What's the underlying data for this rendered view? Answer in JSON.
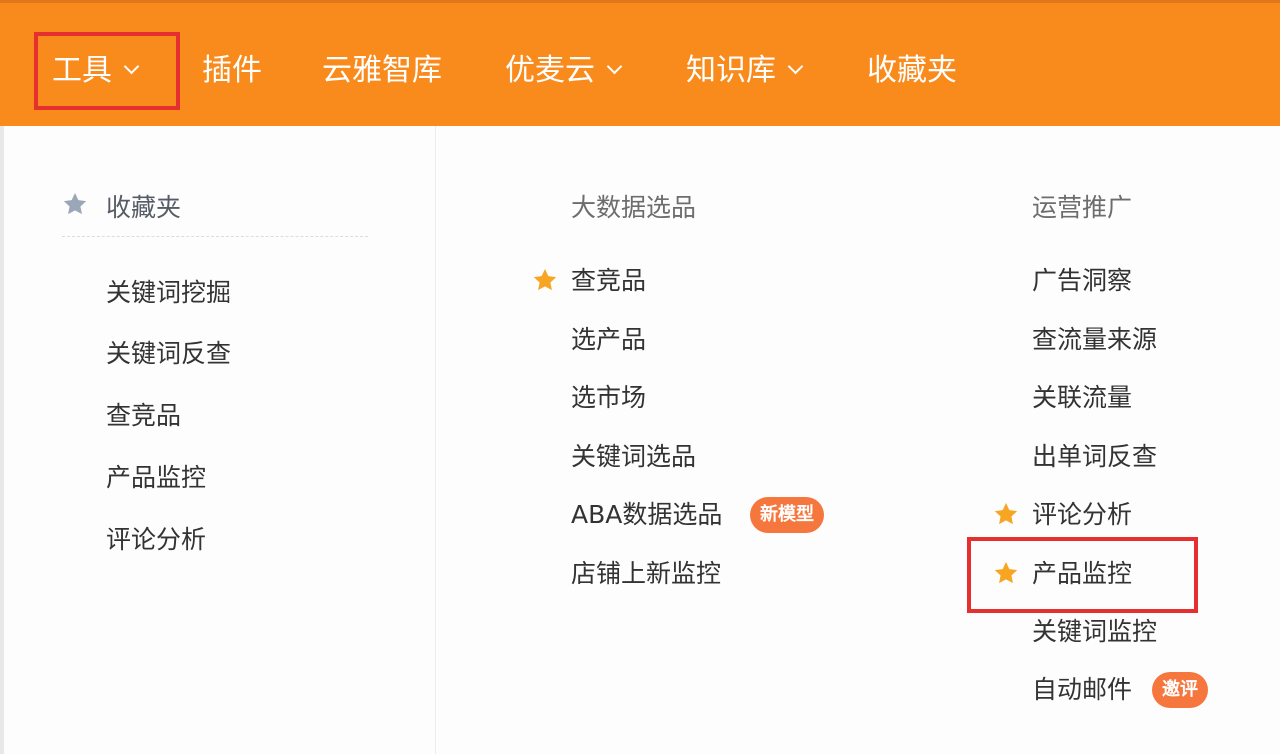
{
  "nav": {
    "tools": "工具",
    "plugins": "插件",
    "yunya": "云雅智库",
    "youmaiyun": "优麦云",
    "knowledge": "知识库",
    "favorites": "收藏夹"
  },
  "favorites_col": {
    "title": "收藏夹",
    "items": [
      "关键词挖掘",
      "关键词反查",
      "查竞品",
      "产品监控",
      "评论分析"
    ]
  },
  "bigdata_col": {
    "title": "大数据选品",
    "items": [
      "查竞品",
      "选产品",
      "选市场",
      "关键词选品",
      "ABA数据选品",
      "店铺上新监控"
    ],
    "badge": "新模型"
  },
  "ops_col": {
    "title": "运营推广",
    "items": [
      "广告洞察",
      "查流量来源",
      "关联流量",
      "出单词反查",
      "评论分析",
      "产品监控",
      "关键词监控",
      "自动邮件"
    ],
    "badge": "邀评"
  },
  "colors": {
    "header": "#f98a1c",
    "highlight": "#e63030",
    "star_gold": "#f6a623",
    "star_gray": "#9aa7b8",
    "badge": "#f5773e"
  },
  "icons": {
    "favorite_star": "star-icon",
    "dropdown": "chevron-down-icon"
  }
}
